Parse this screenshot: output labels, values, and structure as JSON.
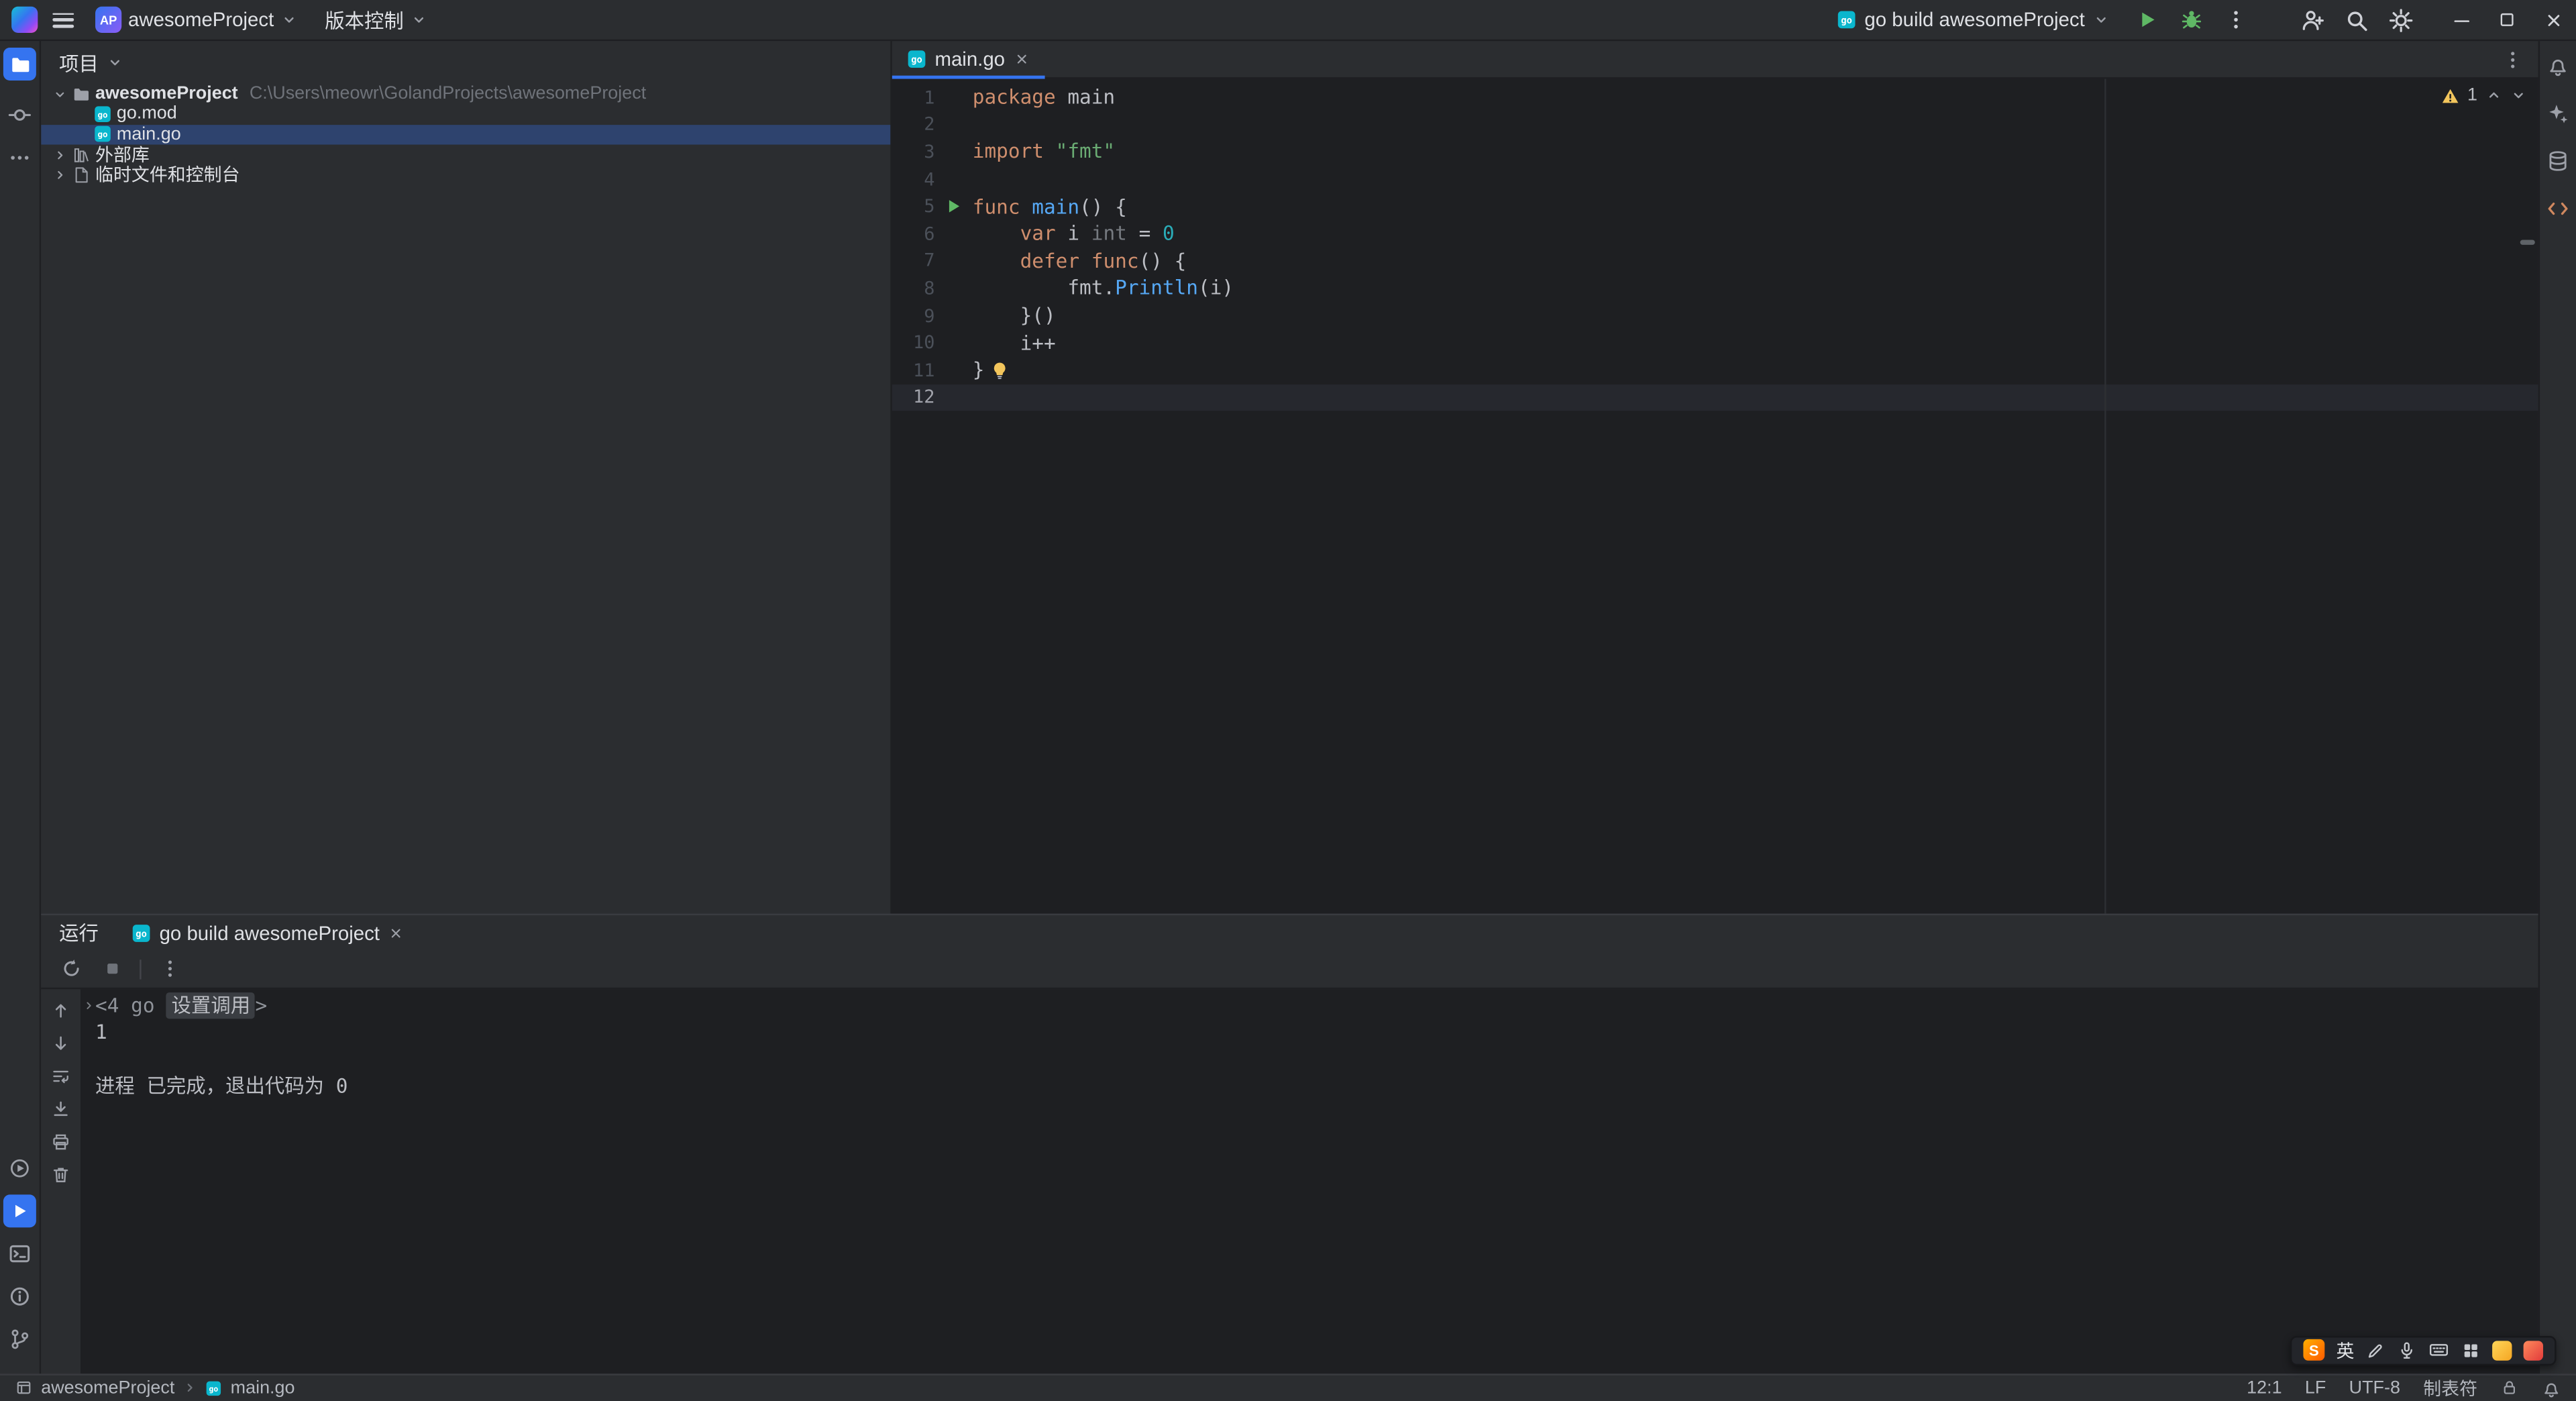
{
  "colors": {
    "accent": "#3574f0",
    "selection": "#2e436e",
    "run_green": "#5fb865",
    "warning_yellow": "#f2c55c",
    "code_keyword": "#cf8e6d",
    "code_string": "#6aab73",
    "code_number": "#2aacb8",
    "code_function": "#56a8f5"
  },
  "titlebar": {
    "project_badge": "AP",
    "project_name": "awesomeProject",
    "vcs_menu": "版本控制",
    "run_config": "go build awesomeProject"
  },
  "project_panel": {
    "header": "项目",
    "root_name": "awesomeProject",
    "root_path": "C:\\Users\\meowr\\GolandProjects\\awesomeProject",
    "children": [
      {
        "label": "go.mod"
      },
      {
        "label": "main.go"
      }
    ],
    "external_libraries": "外部库",
    "scratches": "临时文件和控制台"
  },
  "editor": {
    "tab_label": "main.go",
    "warning_count": "1",
    "code_lines": [
      {
        "n": "1",
        "tokens": [
          [
            "kw",
            "package "
          ],
          [
            "plain",
            "main"
          ]
        ]
      },
      {
        "n": "2",
        "tokens": []
      },
      {
        "n": "3",
        "tokens": [
          [
            "kw",
            "import "
          ],
          [
            "str",
            "\"fmt\""
          ]
        ]
      },
      {
        "n": "4",
        "tokens": []
      },
      {
        "n": "5",
        "run": true,
        "tokens": [
          [
            "kw",
            "func "
          ],
          [
            "fn",
            "main"
          ],
          [
            "plain",
            "() {"
          ]
        ]
      },
      {
        "n": "6",
        "tokens": [
          [
            "plain",
            "\t"
          ],
          [
            "kw",
            "var "
          ],
          [
            "plain",
            "i "
          ],
          [
            "weak",
            "int"
          ],
          [
            "plain",
            " = "
          ],
          [
            "num",
            "0"
          ]
        ]
      },
      {
        "n": "7",
        "tokens": [
          [
            "plain",
            "\t"
          ],
          [
            "kw",
            "defer "
          ],
          [
            "kw",
            "func"
          ],
          [
            "plain",
            "() {"
          ]
        ]
      },
      {
        "n": "8",
        "tokens": [
          [
            "plain",
            "\t\t"
          ],
          [
            "plain",
            "fmt."
          ],
          [
            "fn",
            "Println"
          ],
          [
            "plain",
            "(i)"
          ]
        ]
      },
      {
        "n": "9",
        "tokens": [
          [
            "plain",
            "\t}()"
          ]
        ]
      },
      {
        "n": "10",
        "tokens": [
          [
            "plain",
            "\ti++"
          ]
        ]
      },
      {
        "n": "11",
        "bulb": true,
        "tokens": [
          [
            "plain",
            "}"
          ]
        ]
      },
      {
        "n": "12",
        "current": true,
        "tokens": []
      }
    ]
  },
  "run_panel": {
    "title": "运行",
    "tab_label": "go build awesomeProject",
    "console": {
      "fold_prefix": "<4 go ",
      "fold_label": "设置调用",
      "fold_suffix": ">",
      "output": "1",
      "exit_line": "进程 已完成，退出代码为 0"
    }
  },
  "statusbar": {
    "breadcrumb_project": "awesomeProject",
    "breadcrumb_file": "main.go",
    "caret": "12:1",
    "line_separator": "LF",
    "encoding": "UTF-8",
    "indent": "制表符"
  },
  "ime": {
    "lang": "英"
  }
}
